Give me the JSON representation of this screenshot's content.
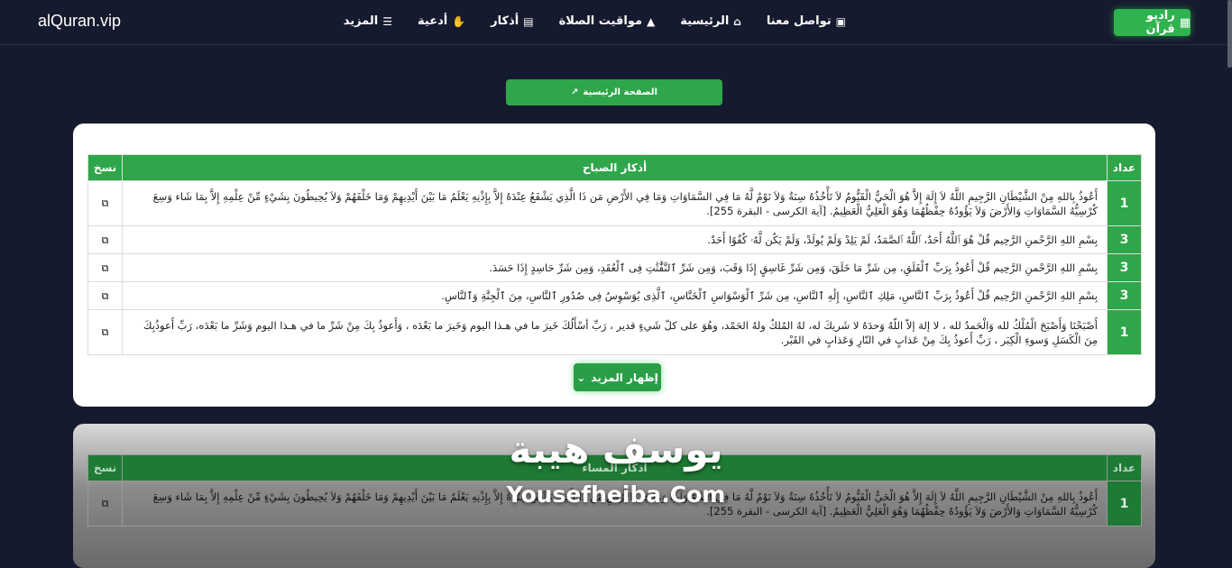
{
  "brand": "alQuran.vip",
  "nav": {
    "radio_label": "راديو قرآن",
    "links": [
      {
        "label": "تواصل معنا",
        "icon": "id-card-icon"
      },
      {
        "label": "الرئيسية",
        "icon": "home-icon"
      },
      {
        "label": "مواقيت الصلاة",
        "icon": "mosque-icon"
      },
      {
        "label": "أذكار",
        "icon": "book-icon"
      },
      {
        "label": "أدعية",
        "icon": "hands-icon"
      },
      {
        "label": "المزيد",
        "icon": "menu-icon"
      }
    ]
  },
  "home_button": "الصفحة الرئيسية",
  "table": {
    "headers": {
      "count": "عداد",
      "title": "أذكار الصباح",
      "copy": "نسخ"
    },
    "rows": [
      {
        "count": "1",
        "text": "أَعُوذُ بِاللهِ مِنْ الشَّيْطَانِ الرَّجِيمِ اللَّهُ لاَ إِلَهَ إِلاَّ هُوَ الْحَيُّ الْقَيُّومُ لاَ تَأْخُذُهُ سِنَةٌ وَلاَ نَوْمٌ لَّهُ مَا فِي السَّمَاوَاتِ وَمَا فِي الأَرْضِ مَن ذَا الَّذِي يَشْفَعُ عِنْدَهُ إِلاَّ بِإِذْنِهِ يَعْلَمُ مَا بَيْنَ أَيْدِيهِمْ وَمَا خَلْفَهُمْ وَلاَ يُحِيطُونَ بِشَيْءٍ مِّنْ عِلْمِهِ إِلاَّ بِمَا شَاء وَسِعَ كُرْسِيُّهُ السَّمَاوَاتِ وَالأَرْضَ وَلاَ يَؤُودُهُ حِفْظُهُمَا وَهُوَ الْعَلِيُّ الْعَظِيمُ. [آية الكرسى - البقرة 255]."
      },
      {
        "count": "3",
        "text": "بِسْمِ اللهِ الرَّحْمنِ الرَّحِيم قُلْ هُوَ ٱللَّهُ أَحَدٌ، ٱللَّهُ ٱلصَّمَدُ، لَمْ يَلِدْ وَلَمْ يُولَدْ، وَلَمْ يَكُن لَّهُۥ كُفُوًا أَحَدٌ."
      },
      {
        "count": "3",
        "text": "بِسْمِ اللهِ الرَّحْمنِ الرَّحِيم قُلْ أَعُوذُ بِرَبِّ ٱلْفَلَقِ، مِن شَرِّ مَا خَلَقَ، وَمِن شَرِّ غَاسِقٍ إِذَا وَقَبَ، وَمِن شَرِّ ٱلنَّفَّٰثَٰتِ فِى ٱلْعُقَدِ، وَمِن شَرِّ حَاسِدٍ إِذَا حَسَدَ."
      },
      {
        "count": "3",
        "text": "بِسْمِ اللهِ الرَّحْمنِ الرَّحِيم قُلْ أَعُوذُ بِرَبِّ ٱلنَّاسِ، مَلِكِ ٱلنَّاسِ، إِلَٰهِ ٱلنَّاسِ، مِن شَرِّ ٱلْوَسْوَاسِ ٱلْخَنَّاسِ، ٱلَّذِى يُوَسْوِسُ فِى صُدُورِ ٱلنَّاسِ، مِنَ ٱلْجِنَّةِ وَٱلنَّاسِ."
      },
      {
        "count": "1",
        "text": "أَصْبَحْنَا وَأَصْبَحَ الْمُلْكُ لله وَالْحَمدُ لله ، لا إلهَ إلاّ اللّهُ وَحدَهُ لا شَريكَ له، لهُ المُلكُ ولهُ الحَمْد، وهُوَ على كلّ شَيءٍ قدير ، رَبِّ أسْأَلُكَ خَيرَ ما في هـذا اليوم وَخَيرَ ما بَعْدَه ، وَأَعوذُ بِكَ مِنْ شَرِّ ما في هـذا اليوم وَشَرِّ ما بَعْدَه، رَبِّ أَعوذُبِكَ مِنَ الْكَسَلِ وَسوءِ الْكِبَر ، رَبِّ أَعوذُ بِكَ مِنْ عَذابٍ في النّارِ وَعَذابٍ في القَبْر."
      }
    ],
    "show_more": "إظهار المزيد"
  },
  "table2": {
    "headers": {
      "count": "عداد",
      "title": "أذكار المساء",
      "copy": "نسخ"
    },
    "rows": [
      {
        "count": "1",
        "text": "أَعُوذُ بِاللهِ مِنْ الشَّيْطَانِ الرَّجِيمِ اللَّهُ لاَ إِلَهَ إِلاَّ هُوَ الْحَيُّ الْقَيُّومُ لاَ تَأْخُذُهُ سِنَةٌ وَلاَ نَوْمٌ لَّهُ مَا فِي السَّمَاوَاتِ وَمَا فِي الأَرْضِ مَن ذَا الَّذِي يَشْفَعُ عِنْدَهُ إِلاَّ بِإِذْنِهِ يَعْلَمُ مَا بَيْنَ أَيْدِيهِمْ وَمَا خَلْفَهُمْ وَلاَ يُحِيطُونَ بِشَيْءٍ مِّنْ عِلْمِهِ إِلاَّ بِمَا شَاء وَسِعَ كُرْسِيُّهُ السَّمَاوَاتِ وَالأَرْضَ وَلاَ يَؤُودُهُ حِفْظُهُمَا وَهُوَ الْعَلِيُّ الْعَظِيمُ. [آية الكرسى - البقرة 255]."
      }
    ]
  },
  "watermark": {
    "arabic": "يوسف هيبة",
    "english": "Yousefheiba.Com"
  }
}
